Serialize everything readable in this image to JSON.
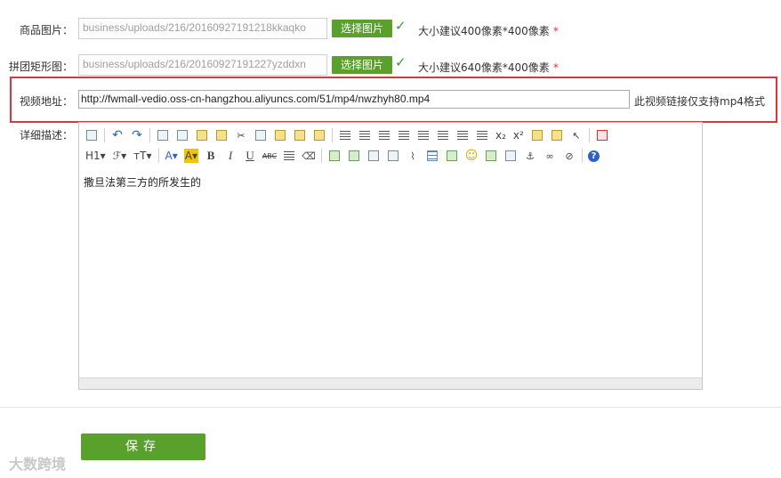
{
  "form": {
    "product_image": {
      "label": "商品图片：",
      "value": "business/uploads/216/20160927191218kkaqko",
      "button": "选择图片",
      "hint": "大小建议400像素*400像素",
      "required_mark": "*"
    },
    "group_image": {
      "label": "拼团矩形图：",
      "value": "business/uploads/216/20160927191227yzddxn",
      "button": "选择图片",
      "hint": "大小建议640像素*400像素",
      "required_mark": "*"
    },
    "video": {
      "label": "视频地址：",
      "value": "http://fwmall-vedio.oss-cn-hangzhou.aliyuncs.com/51/mp4/nwzhyh80.mp4",
      "hint": "此视频链接仅支持mp4格式"
    },
    "description": {
      "label": "详细描述：",
      "content": "撒旦法第三方的所发生的"
    }
  },
  "toolbar": {
    "h1": "H1",
    "font_family": "ℱ",
    "font_size": "тT",
    "font_color": "A",
    "bg_color": "A",
    "bold": "B",
    "italic": "I",
    "underline": "U",
    "strike": "ABC",
    "subscript": "x₂",
    "superscript": "x²"
  },
  "save_label": "保存",
  "watermark": "大数跨境",
  "colors": {
    "accent": "#5aa02c",
    "highlight_border": "#d9363e"
  }
}
